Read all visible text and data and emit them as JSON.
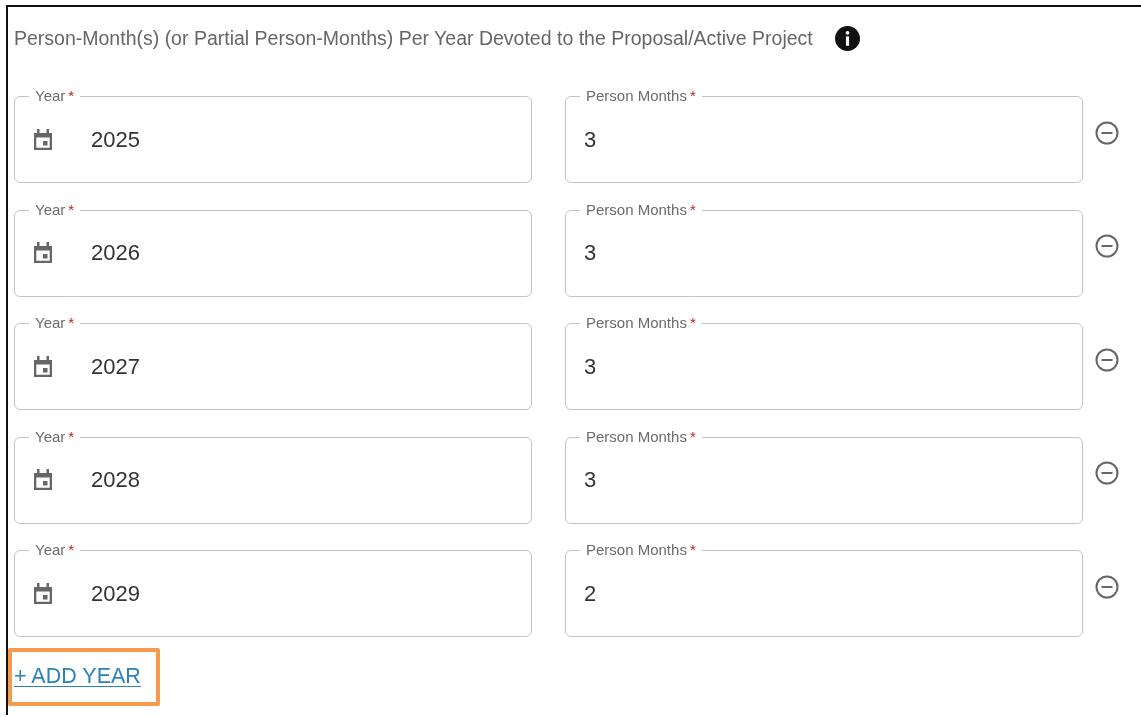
{
  "section": {
    "title": "Person-Month(s) (or Partial Person-Months) Per Year Devoted to the Proposal/Active Project",
    "rows": [
      {
        "year": {
          "label": "Year",
          "required_mark": "*",
          "value": "2025"
        },
        "person_months": {
          "label": "Person Months",
          "required_mark": "*",
          "value": "3"
        }
      },
      {
        "year": {
          "label": "Year",
          "required_mark": "*",
          "value": "2026"
        },
        "person_months": {
          "label": "Person Months",
          "required_mark": "*",
          "value": "3"
        }
      },
      {
        "year": {
          "label": "Year",
          "required_mark": "*",
          "value": "2027"
        },
        "person_months": {
          "label": "Person Months",
          "required_mark": "*",
          "value": "3"
        }
      },
      {
        "year": {
          "label": "Year",
          "required_mark": "*",
          "value": "2028"
        },
        "person_months": {
          "label": "Person Months",
          "required_mark": "*",
          "value": "3"
        }
      },
      {
        "year": {
          "label": "Year",
          "required_mark": "*",
          "value": "2029"
        },
        "person_months": {
          "label": "Person Months",
          "required_mark": "*",
          "value": "2"
        }
      }
    ],
    "add_button": {
      "label": "+ ADD YEAR",
      "highlighted": true
    }
  }
}
